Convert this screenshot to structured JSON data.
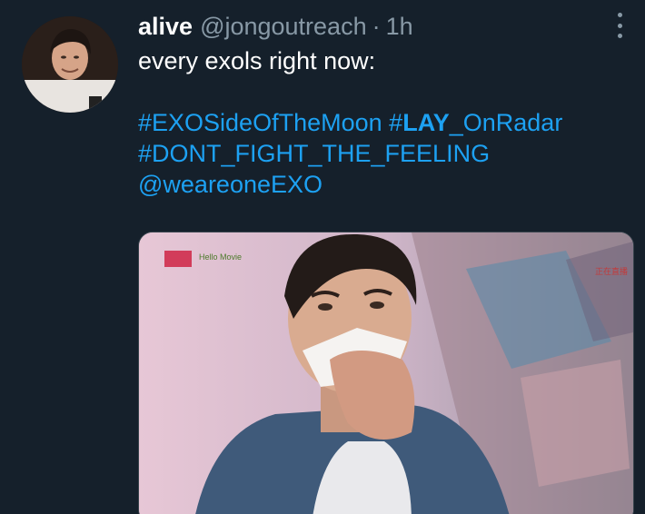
{
  "tweet": {
    "author": {
      "display_name": "alive",
      "handle": "@jongoutreach",
      "separator": "·",
      "time": "1h"
    },
    "more_icon": "more-vertical-icon",
    "text": {
      "line1": "every exols right now:",
      "hashtag1": "#EXOSideOfTheMoon",
      "hashtag2_prefix": "#",
      "hashtag2_bold": "LAY",
      "hashtag2_suffix": "_OnRadar",
      "hashtag3": "#DONT_FIGHT_THE_FEELING",
      "mention": "@weareoneEXO"
    },
    "media": {
      "watermark_left": "Hello Movie",
      "watermark_right": "正在直播"
    }
  },
  "colors": {
    "background": "#15202b",
    "text": "#ffffff",
    "secondary": "#8899a6",
    "link": "#1da1f2"
  }
}
